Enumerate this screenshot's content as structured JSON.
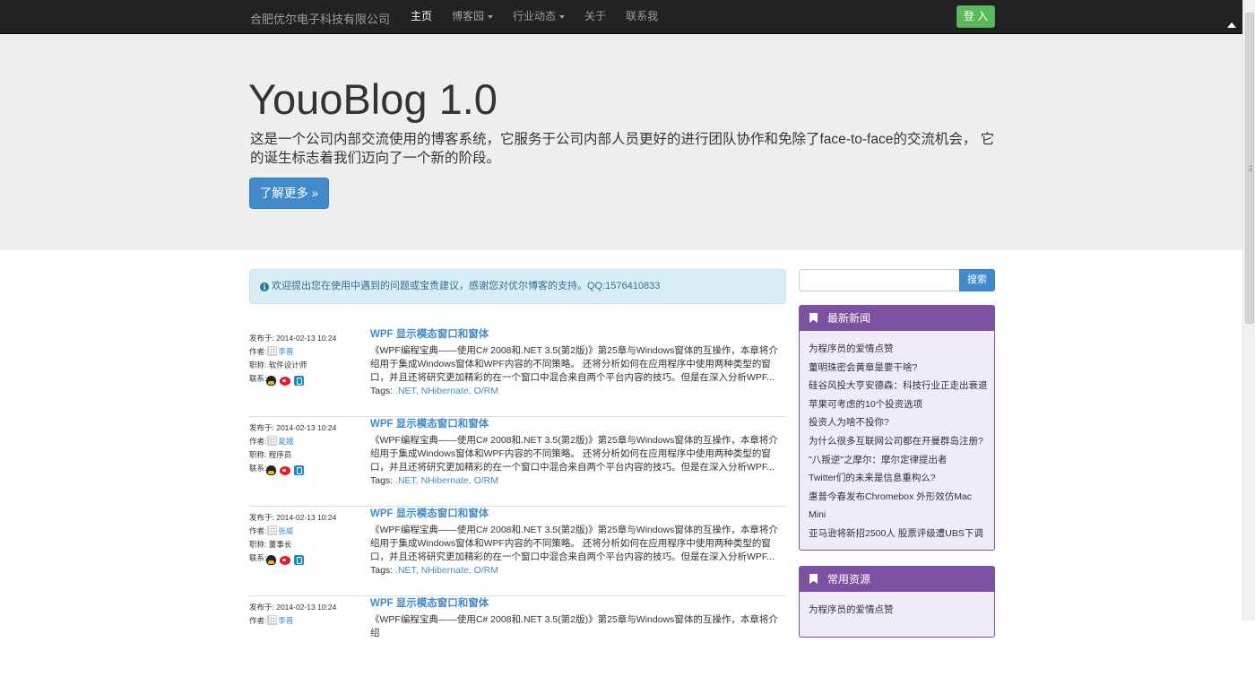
{
  "navbar": {
    "brand": "合肥优尔电子科技有限公司",
    "items": [
      {
        "label": "主页"
      },
      {
        "label": "博客园"
      },
      {
        "label": "行业动态"
      },
      {
        "label": "关于"
      },
      {
        "label": "联系我"
      }
    ],
    "login": "登 入"
  },
  "jumbotron": {
    "title": "YouoBlog 1.0",
    "description": "这是一个公司内部交流使用的博客系统，它服务于公司内部人员更好的进行团队协作和免除了face-to-face的交流机会， 它的诞生标志着我们迈向了一个新的阶段。",
    "button": "了解更多 »"
  },
  "alert": {
    "text": "欢迎提出您在使用中遇到的问题或宝贵建议，感谢您对优尔博客的支持。QQ:1576410833"
  },
  "posts": [
    {
      "date": "发布于: 2014-02-13 10:24",
      "author_prefix": "作者:",
      "author": "李晋",
      "role": "职称: 软件设计师",
      "contact": "联系:",
      "title": "WPF 显示模态窗口和窗体",
      "excerpt": "《WPF编程宝典——使用C# 2008和.NET 3.5(第2版)》第25章与Windows窗体的互操作，本章将介绍用于集成Windows窗体和WPF内容的不同策略。 还将分析如何在应用程序中使用两种类型的窗口，并且还将研究更加精彩的在一个窗口中混合来自两个平台内容的技巧。但是在深入分析WPF...",
      "tags_label": "Tags:",
      "tags": ".NET, NHibernate, O/RM"
    },
    {
      "date": "发布于: 2014-02-13 10:24",
      "author_prefix": "作者:",
      "author": "夏娥",
      "role": "职称: 程序员",
      "contact": "联系:",
      "title": "WPF 显示模态窗口和窗体",
      "excerpt": "《WPF编程宝典——使用C# 2008和.NET 3.5(第2版)》第25章与Windows窗体的互操作，本章将介绍用于集成Windows窗体和WPF内容的不同策略。 还将分析如何在应用程序中使用两种类型的窗口，并且还将研究更加精彩的在一个窗口中混合来自两个平台内容的技巧。但是在深入分析WPF...",
      "tags_label": "Tags:",
      "tags": ".NET, NHibernate, O/RM"
    },
    {
      "date": "发布于: 2014-02-13 10:24",
      "author_prefix": "作者:",
      "author": "张威",
      "role": "职称: 董事长",
      "contact": "联系:",
      "title": "WPF 显示模态窗口和窗体",
      "excerpt": "《WPF编程宝典——使用C# 2008和.NET 3.5(第2版)》第25章与Windows窗体的互操作，本章将介绍用于集成Windows窗体和WPF内容的不同策略。 还将分析如何在应用程序中使用两种类型的窗口，并且还将研究更加精彩的在一个窗口中混合来自两个平台内容的技巧。但是在深入分析WPF...",
      "tags_label": "Tags:",
      "tags": ".NET, NHibernate, O/RM"
    },
    {
      "date": "发布于: 2014-02-13 10:24",
      "author_prefix": "作者:",
      "author": "李晋",
      "role": "",
      "contact": "",
      "title": "WPF 显示模态窗口和窗体",
      "excerpt": "《WPF编程宝典——使用C# 2008和.NET 3.5(第2版)》第25章与Windows窗体的互操作，本章将介绍",
      "tags_label": "",
      "tags": ""
    }
  ],
  "sidebar": {
    "search_button": "搜索",
    "search_placeholder": "",
    "news_heading": "最新新闻",
    "news": [
      "为程序员的爱情点赞",
      "董明珠密会黄章是要干啥?",
      "硅谷风投大亨安德森：科技行业正走出衰退",
      "苹果可考虑的10个投资选项",
      "投资人为啥不投你?",
      "为什么很多互联网公司都在开曼群岛注册?",
      "\"八叛逆\"之摩尔：摩尔定律提出者",
      "Twitter们的未来是信息重构么?",
      "惠普今春发布Chromebox 外形效仿Mac Mini",
      "亚马逊将新招2500人 股票评级遭UBS下调"
    ],
    "resources_heading": "常用资源",
    "resources": [
      "为程序员的爱情点赞"
    ]
  }
}
